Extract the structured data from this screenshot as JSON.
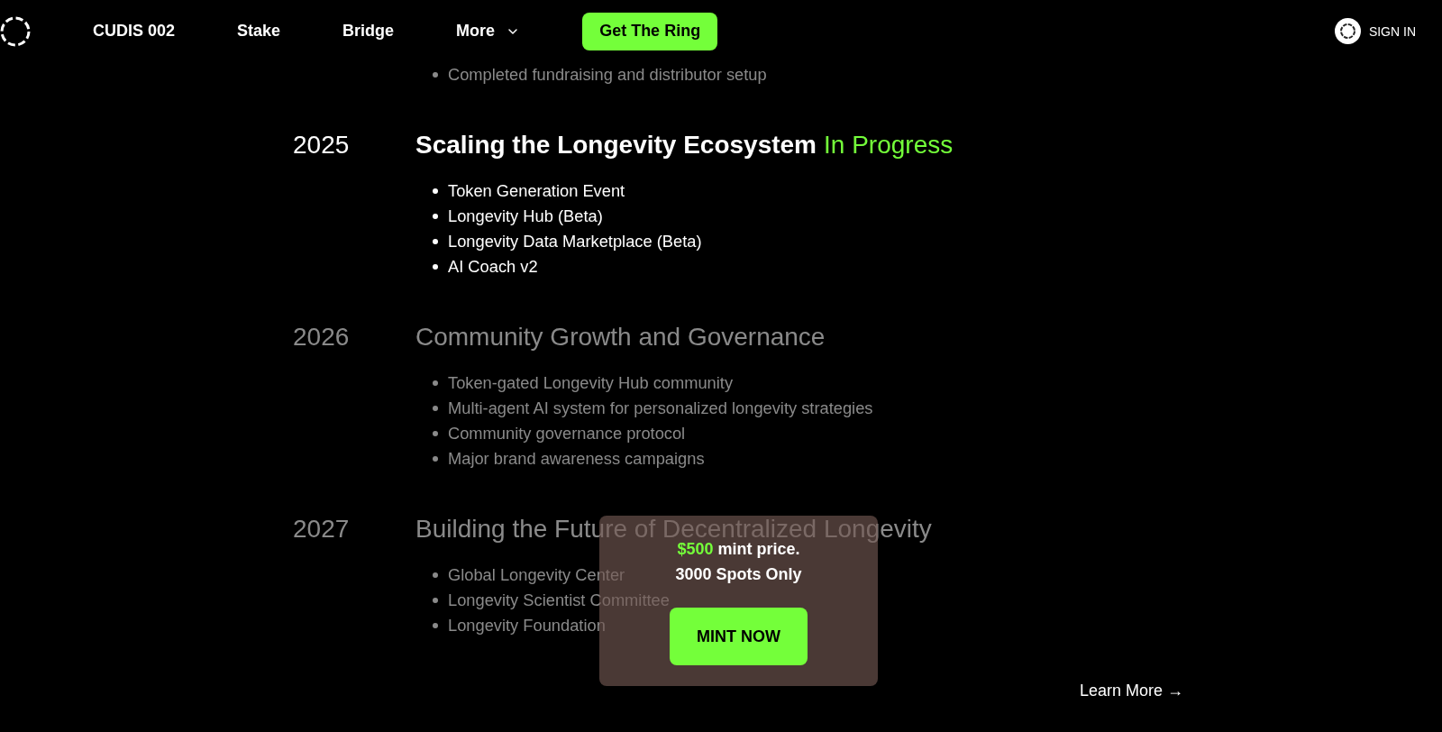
{
  "nav": {
    "links": [
      {
        "label": "CUDIS 002",
        "dropdown": false
      },
      {
        "label": "Stake",
        "dropdown": false
      },
      {
        "label": "Bridge",
        "dropdown": false
      },
      {
        "label": "More",
        "dropdown": true
      }
    ],
    "cta": "Get The Ring",
    "sign_in": "SIGN IN"
  },
  "milestones": [
    {
      "active": false,
      "items": [
        "Completed fundraising and distributor setup"
      ]
    },
    {
      "year": "2025",
      "title": "Scaling the Longevity Ecosystem",
      "status": "In Progress",
      "active": true,
      "items": [
        "Token Generation Event",
        "Longevity Hub (Beta)",
        "Longevity Data Marketplace (Beta)",
        "AI Coach v2"
      ]
    },
    {
      "year": "2026",
      "title": "Community Growth and Governance",
      "active": false,
      "items": [
        "Token-gated Longevity Hub community",
        "Multi-agent AI system for personalized longevity strategies",
        "Community governance protocol",
        "Major brand awareness campaigns"
      ]
    },
    {
      "year": "2027",
      "title": "Building the Future of Decentralized Longevity",
      "active": false,
      "items": [
        "Global Longevity Center",
        "Longevity Scientist Committee",
        "Longevity Foundation"
      ]
    }
  ],
  "learn_more": "Learn More →",
  "mint_popup": {
    "price": "$500",
    "price_text": "mint price.",
    "spots": "3000 Spots Only",
    "button": "MINT NOW"
  }
}
